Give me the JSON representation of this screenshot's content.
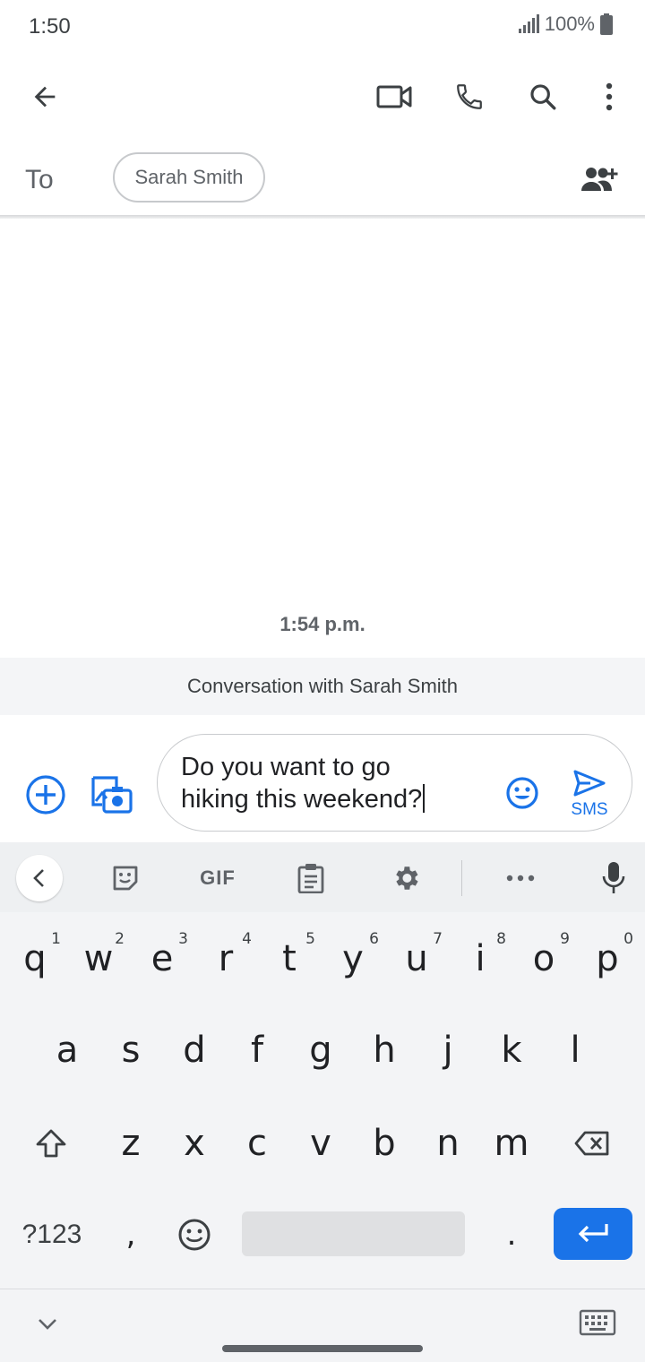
{
  "status": {
    "time": "1:50",
    "battery": "100%"
  },
  "toolbar": {
    "icons": [
      "arrow-back-icon",
      "video-call-icon",
      "phone-icon",
      "search-icon",
      "more-vert-icon"
    ]
  },
  "recipients": {
    "to_label": "To",
    "chip": "Sarah Smith"
  },
  "conversation": {
    "timestamp": "1:54 p.m.",
    "banner": "Conversation with Sarah Smith"
  },
  "compose": {
    "line1": "Do you want to go",
    "line2": "hiking this weekend?",
    "send_label": "SMS"
  },
  "keyboard": {
    "toolbar": {
      "gif": "GIF"
    },
    "row1": [
      {
        "k": "q",
        "h": "1"
      },
      {
        "k": "w",
        "h": "2"
      },
      {
        "k": "e",
        "h": "3"
      },
      {
        "k": "r",
        "h": "4"
      },
      {
        "k": "t",
        "h": "5"
      },
      {
        "k": "y",
        "h": "6"
      },
      {
        "k": "u",
        "h": "7"
      },
      {
        "k": "i",
        "h": "8"
      },
      {
        "k": "o",
        "h": "9"
      },
      {
        "k": "p",
        "h": "0"
      }
    ],
    "row2": [
      "a",
      "s",
      "d",
      "f",
      "g",
      "h",
      "j",
      "k",
      "l"
    ],
    "row3": [
      "z",
      "x",
      "c",
      "v",
      "b",
      "n",
      "m"
    ],
    "bottom": {
      "symbols": "?123",
      "comma": ",",
      "period": "."
    }
  },
  "colors": {
    "accent": "#1a73e8",
    "keyboard_bg": "#f3f4f6"
  }
}
